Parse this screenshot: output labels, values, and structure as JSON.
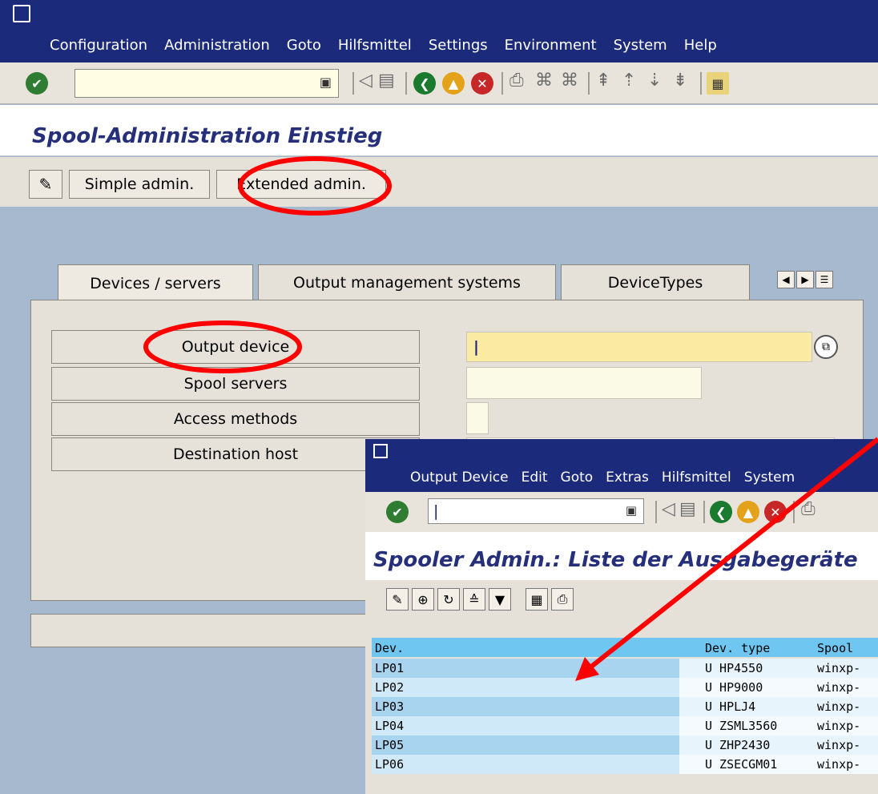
{
  "main": {
    "menu": [
      "Configuration",
      "Administration",
      "Goto",
      "Hilfsmittel",
      "Settings",
      "Environment",
      "System",
      "Help"
    ],
    "title": "Spool-Administration Einstieg",
    "app_toolbar": {
      "simple": "Simple admin.",
      "extended": "Extended admin."
    },
    "tabs": [
      "Devices / servers",
      "Output management systems",
      "DeviceTypes"
    ],
    "buttons": [
      "Output device",
      "Spool servers",
      "Access methods",
      "Destination host"
    ],
    "output_device_value": "|"
  },
  "overlay": {
    "menu": [
      "Output Device",
      "Edit",
      "Goto",
      "Extras",
      "Hilfsmittel",
      "System"
    ],
    "command_value": "|",
    "title": "Spooler Admin.: Liste der Ausgabegeräte",
    "table": {
      "headers": [
        "Dev.",
        "Dev. type",
        "Spool"
      ],
      "rows": [
        [
          "LP01",
          "U HP4550",
          "winxp-"
        ],
        [
          "LP02",
          "U HP9000",
          "winxp-"
        ],
        [
          "LP03",
          "U HPLJ4",
          "winxp-"
        ],
        [
          "LP04",
          "U ZSML3560",
          "winxp-"
        ],
        [
          "LP05",
          "U ZHP2430",
          "winxp-"
        ],
        [
          "LP06",
          "U ZSECGM01",
          "winxp-"
        ]
      ]
    }
  },
  "colors": {
    "menubar": "#1c2a7c",
    "title": "#26307a",
    "highlight": "#ff0000",
    "row_dark": "#a8d4ef",
    "row_light": "#cfe9f8"
  }
}
